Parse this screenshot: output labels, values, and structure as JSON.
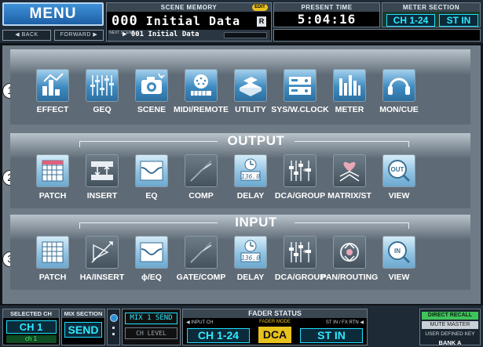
{
  "header": {
    "menu_label": "MENU",
    "back_label": "◀ BACK",
    "forward_label": "FORWARD ▶",
    "scene_memory": {
      "header": "SCENE MEMORY",
      "edit_badge": "EDIT",
      "number": "000",
      "title": "Initial Data",
      "r_badge": "R",
      "next_label": "NEXT SCENE",
      "next_text": "▶ 001 Initial Data"
    },
    "present_time": {
      "header": "PRESENT TIME",
      "time": "5:04:16"
    },
    "meter_section": {
      "header": "METER SECTION",
      "ch_label": "CH 1-24",
      "st_label": "ST IN"
    }
  },
  "menu_row": {
    "marker": "1",
    "items": [
      {
        "label": "EFFECT",
        "icon": "effect-icon"
      },
      {
        "label": "GEQ",
        "icon": "geq-icon"
      },
      {
        "label": "SCENE",
        "icon": "scene-icon"
      },
      {
        "label": "MIDI/REMOTE",
        "icon": "midi-remote-icon"
      },
      {
        "label": "UTILITY",
        "icon": "utility-icon"
      },
      {
        "label": "SYS/W.CLOCK",
        "icon": "sys-wclock-icon"
      },
      {
        "label": "METER",
        "icon": "meter-icon"
      },
      {
        "label": "MON/CUE",
        "icon": "mon-cue-icon"
      }
    ]
  },
  "output_row": {
    "marker": "2",
    "title": "OUTPUT",
    "items": [
      {
        "label": "PATCH",
        "icon": "patch-icon"
      },
      {
        "label": "INSERT",
        "icon": "insert-icon"
      },
      {
        "label": "EQ",
        "icon": "eq-icon"
      },
      {
        "label": "COMP",
        "icon": "comp-icon"
      },
      {
        "label": "DELAY",
        "icon": "delay-icon",
        "display": "136.0"
      },
      {
        "label": "DCA/GROUP",
        "icon": "dca-group-icon"
      },
      {
        "label": "MATRIX/ST",
        "icon": "matrix-st-icon"
      },
      {
        "label": "VIEW",
        "icon": "view-icon",
        "display": "OUT"
      }
    ]
  },
  "input_row": {
    "marker": "3",
    "title": "INPUT",
    "items": [
      {
        "label": "PATCH",
        "icon": "patch-icon"
      },
      {
        "label": "HA/INSERT",
        "icon": "ha-insert-icon"
      },
      {
        "label": "ϕ/EQ",
        "icon": "phase-eq-icon"
      },
      {
        "label": "GATE/COMP",
        "icon": "gate-comp-icon"
      },
      {
        "label": "DELAY",
        "icon": "delay-icon",
        "display": "136.0"
      },
      {
        "label": "DCA/GROUP",
        "icon": "dca-group-icon"
      },
      {
        "label": "PAN/ROUTING",
        "icon": "pan-routing-icon"
      },
      {
        "label": "VIEW",
        "icon": "view-icon",
        "display": "IN"
      }
    ]
  },
  "footer": {
    "selected_ch": {
      "header": "SELECTED CH",
      "value": "CH 1",
      "sub": "ch 1"
    },
    "mix_section": {
      "header": "MIX SECTION",
      "value": "SEND"
    },
    "mix_display": {
      "line1": "MIX 1 SEND",
      "line2": "CH LEVEL"
    },
    "fader_status": {
      "header": "FADER STATUS",
      "input_label": "◀ INPUT CH",
      "fader_mode_label": "FADER MODE",
      "stin_label": "ST IN / FX RTN ◀",
      "input_value": "CH 1-24",
      "mode_value": "DCA",
      "stin_value": "ST IN"
    },
    "user_keys": {
      "direct_recall": "DIRECT RECALL",
      "mute_master": "MUTE MASTER",
      "user_defined_key": "USER DEFINED KEY",
      "bank": "BANK A"
    }
  },
  "colors": {
    "accent_cyan": "#2de9ff",
    "menu_blue": "#3f92d8",
    "panel_gray": "#6e7b86",
    "fader_mode_yellow": "#e8c21c",
    "recall_green": "#3fc45a"
  }
}
